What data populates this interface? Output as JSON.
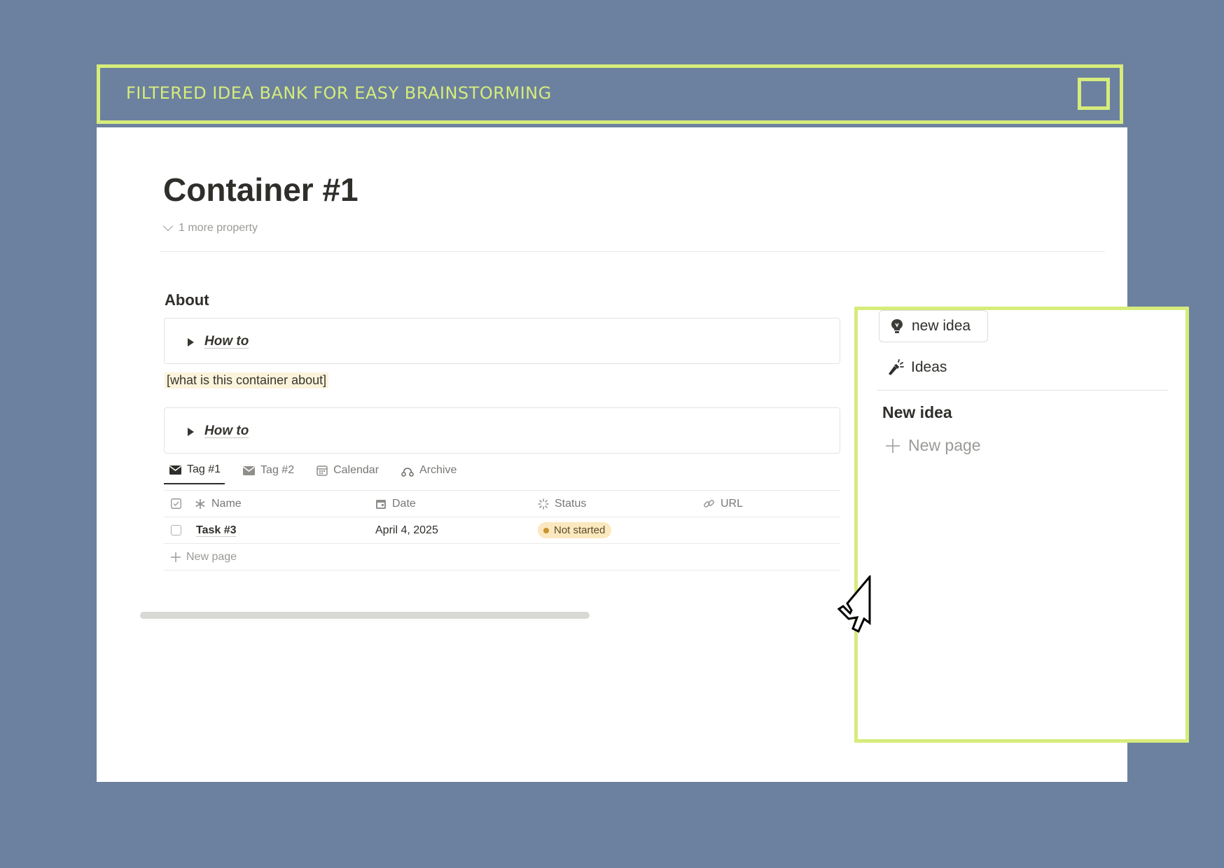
{
  "banner": {
    "title": "FILTERED IDEA BANK FOR EASY BRAINSTORMING"
  },
  "page": {
    "title": "Container #1",
    "more_property": "1 more property",
    "about_heading": "About",
    "toggles": [
      {
        "label": "How to"
      },
      {
        "label": "How to"
      }
    ],
    "about_text": "[what is this container about]"
  },
  "tabs": [
    {
      "label": "Tag #1",
      "icon": "envelope-icon",
      "active": true
    },
    {
      "label": "Tag #2",
      "icon": "envelope-icon",
      "active": false
    },
    {
      "label": "Calendar",
      "icon": "calendar-icon",
      "active": false
    },
    {
      "label": "Archive",
      "icon": "archive-icon",
      "active": false
    }
  ],
  "table": {
    "columns": [
      {
        "label": "Name",
        "icon": "asterisk-icon"
      },
      {
        "label": "Date",
        "icon": "calendar-icon"
      },
      {
        "label": "Status",
        "icon": "status-icon"
      },
      {
        "label": "URL",
        "icon": "link-icon"
      }
    ],
    "rows": [
      {
        "name": "Task #3",
        "date": "April 4, 2025",
        "status": "Not started"
      }
    ],
    "new_page": "New page"
  },
  "side_panel": {
    "new_idea_button": "new idea",
    "ideas_label": "Ideas",
    "heading": "New idea",
    "new_page": "New page"
  },
  "colors": {
    "background": "#6c819f",
    "accent": "#d6ec7c",
    "status_not_started": "#fbe8be"
  }
}
